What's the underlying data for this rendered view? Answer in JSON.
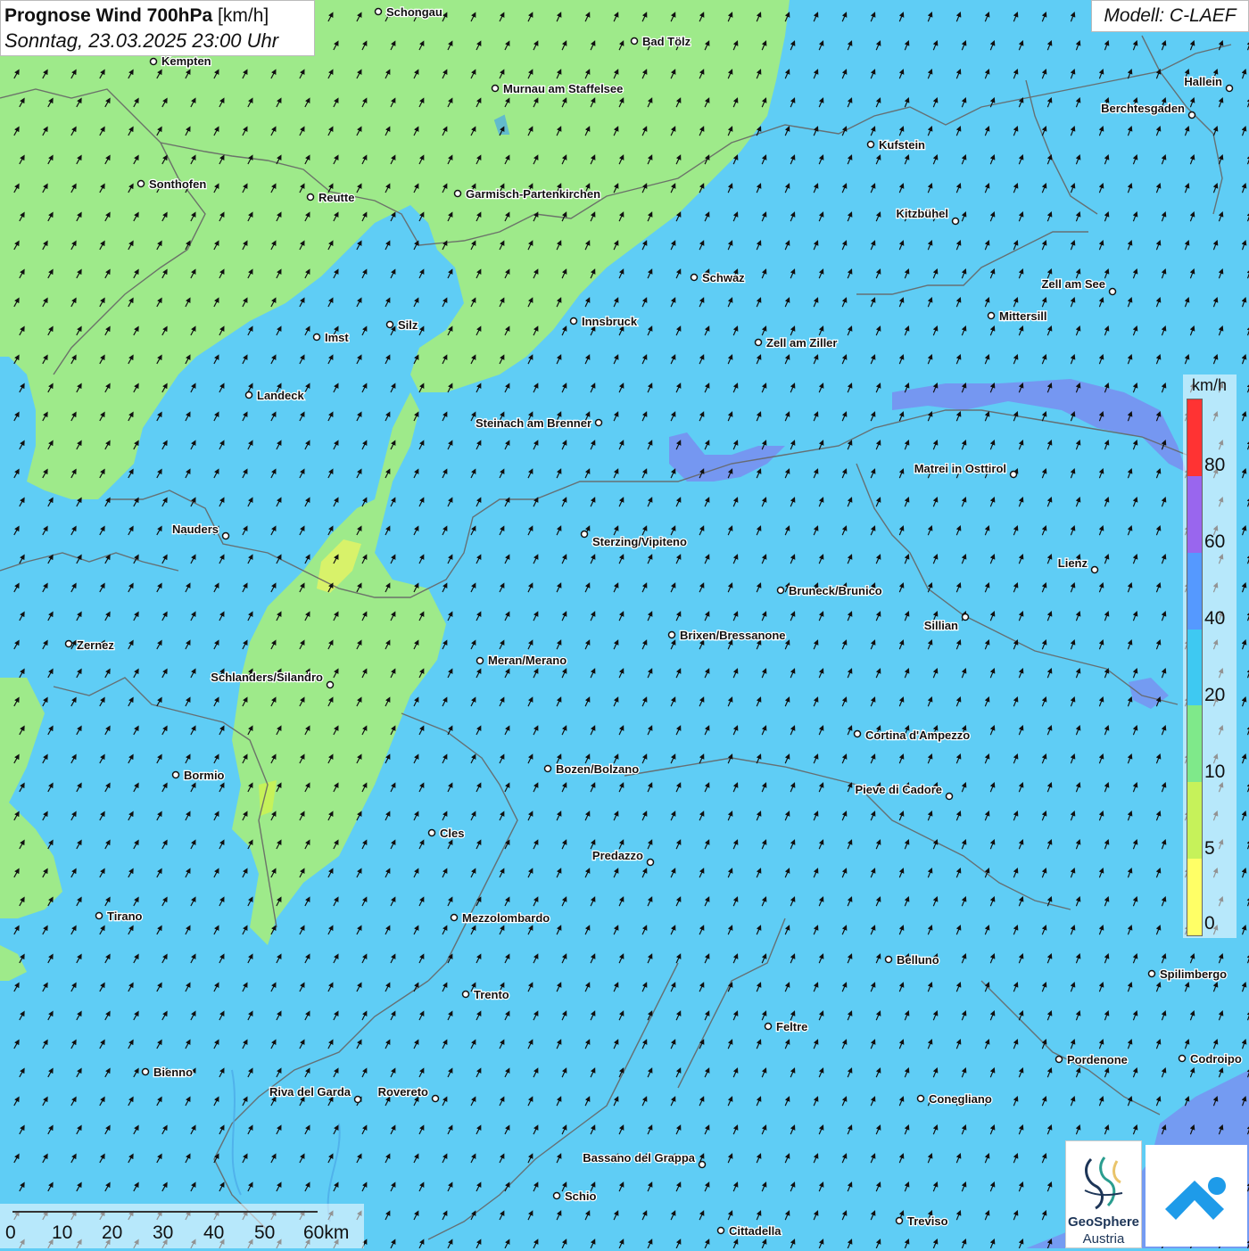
{
  "header": {
    "title_bold": "Prognose Wind 700hPa",
    "title_unit": "[km/h]",
    "datetime": "Sonntag, 23.03.2025 23:00 Uhr"
  },
  "model": "Modell: C-LAEF",
  "legend": {
    "unit": "km/h",
    "levels": [
      {
        "label": "80",
        "color": "#ff3333"
      },
      {
        "label": "60",
        "color": "#9966ee"
      },
      {
        "label": "40",
        "color": "#5599ff"
      },
      {
        "label": "20",
        "color": "#3ec9f2"
      },
      {
        "label": "10",
        "color": "#7fe98a"
      },
      {
        "label": "5",
        "color": "#c6f25a"
      },
      {
        "label": "0",
        "color": "#ffff66"
      }
    ],
    "colors": {
      "ocean_base": "#5fcdf5",
      "calm_green": "#9eea8a",
      "violet": "#7b8af0"
    }
  },
  "scale_bar": {
    "labels": [
      "0",
      "10",
      "20",
      "30",
      "40",
      "50",
      "60km"
    ]
  },
  "logos": {
    "geosphere_line1": "GeoSphere",
    "geosphere_line2": "Austria",
    "geosphere_icon": "geosphere-logo-icon",
    "cloud_icon": "cloud-app-icon"
  },
  "cities": [
    {
      "name": "Schongau"
    },
    {
      "name": "Bad Tölz"
    },
    {
      "name": "Kempten"
    },
    {
      "name": "Murnau am Staffelsee"
    },
    {
      "name": "Hallein"
    },
    {
      "name": "Berchtesgaden"
    },
    {
      "name": "Kufstein"
    },
    {
      "name": "Sonthofen"
    },
    {
      "name": "Reutte"
    },
    {
      "name": "Garmisch-Partenkirchen"
    },
    {
      "name": "Kitzbühel"
    },
    {
      "name": "Schwaz"
    },
    {
      "name": "Zell am See"
    },
    {
      "name": "Mittersill"
    },
    {
      "name": "Innsbruck"
    },
    {
      "name": "Imst"
    },
    {
      "name": "Silz"
    },
    {
      "name": "Zell am Ziller"
    },
    {
      "name": "Landeck"
    },
    {
      "name": "Steinach am Brenner"
    },
    {
      "name": "Matrei in Osttirol"
    },
    {
      "name": "Nauders"
    },
    {
      "name": "Sterzing/Vipiteno"
    },
    {
      "name": "Lienz"
    },
    {
      "name": "Bruneck/Brunico"
    },
    {
      "name": "Sillian"
    },
    {
      "name": "Zernez"
    },
    {
      "name": "Brixen/Bressanone"
    },
    {
      "name": "Meran/Merano"
    },
    {
      "name": "Schlanders/Silandro"
    },
    {
      "name": "Cortina d'Ampezzo"
    },
    {
      "name": "Bormio"
    },
    {
      "name": "Bozen/Bolzano"
    },
    {
      "name": "Pieve di Cadore"
    },
    {
      "name": "Cles"
    },
    {
      "name": "Predazzo"
    },
    {
      "name": "Tirano"
    },
    {
      "name": "Mezzolombardo"
    },
    {
      "name": "Belluno"
    },
    {
      "name": "Spilimbergo"
    },
    {
      "name": "Trento"
    },
    {
      "name": "Feltre"
    },
    {
      "name": "Pordenone"
    },
    {
      "name": "Codroipo"
    },
    {
      "name": "Bienno"
    },
    {
      "name": "Riva del Garda"
    },
    {
      "name": "Rovereto"
    },
    {
      "name": "Conegliano"
    },
    {
      "name": "Bassano del Grappa"
    },
    {
      "name": "Schio"
    },
    {
      "name": "Treviso"
    },
    {
      "name": "Cittadella"
    }
  ]
}
